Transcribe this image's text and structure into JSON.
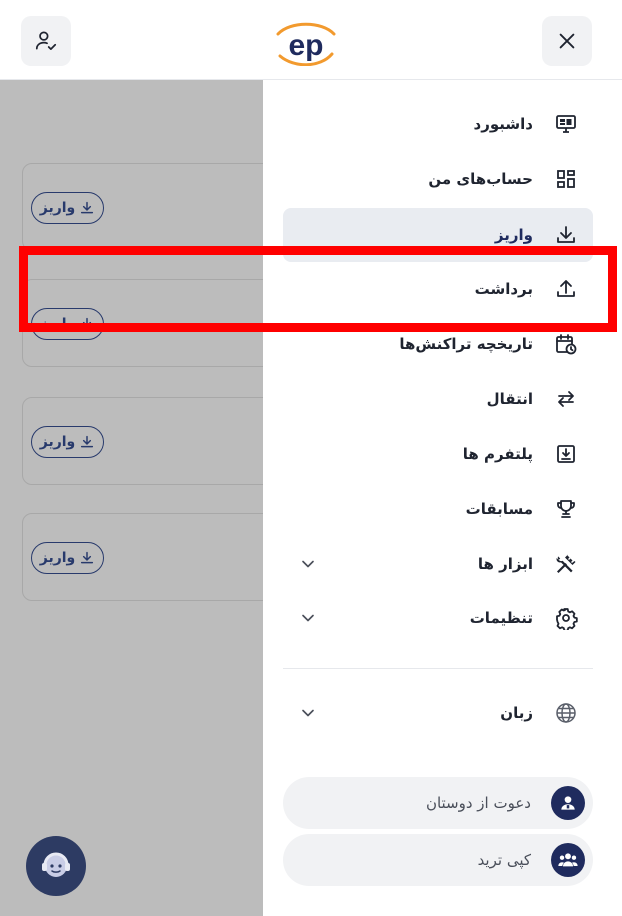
{
  "header": {
    "logo_text": "ep",
    "profile_icon": "user-check-icon",
    "close_icon": "close-icon"
  },
  "background": {
    "deposit_label": "واریز",
    "cards": [
      {
        "deposit_label": "واریز"
      },
      {
        "deposit_label": "واریز"
      },
      {
        "deposit_label": "واریز"
      },
      {
        "deposit_label": "واریز"
      }
    ]
  },
  "menu": {
    "items": [
      {
        "label": "داشبورد",
        "icon": "monitor-icon"
      },
      {
        "label": "حساب‌های من",
        "icon": "grid-icon"
      },
      {
        "label": "واریز",
        "icon": "download-icon",
        "active": true
      },
      {
        "label": "برداشت",
        "icon": "upload-icon"
      },
      {
        "label": "تاریخچه تراکنش‌ها",
        "icon": "calendar-clock-icon"
      },
      {
        "label": "انتقال",
        "icon": "transfer-icon"
      },
      {
        "label": "پلتفرم ها",
        "icon": "platform-download-icon"
      },
      {
        "label": "مسابقات",
        "icon": "trophy-icon"
      },
      {
        "label": "ابزار ها",
        "icon": "tools-icon",
        "expandable": true
      },
      {
        "label": "تنظیمات",
        "icon": "gear-icon",
        "expandable": true
      }
    ],
    "language": {
      "label": "زبان",
      "icon": "globe-icon",
      "expandable": true
    }
  },
  "actions": {
    "invite": {
      "label": "دعوت از دوستان",
      "icon": "invite-user-icon"
    },
    "copy_trade": {
      "label": "کپی ترید",
      "icon": "group-icon"
    }
  },
  "support_icon": "support-agent-icon",
  "colors": {
    "brand_navy": "#1f2b5e",
    "brand_orange": "#f29a2e",
    "active_bg": "#e9ecf1",
    "highlight": "#ff0000"
  }
}
